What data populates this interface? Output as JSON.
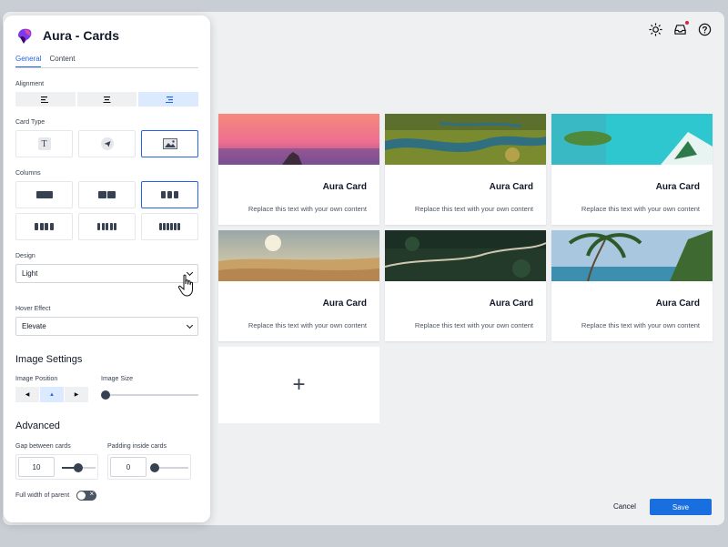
{
  "app": {
    "title": "Aura - Cards"
  },
  "tabs": [
    {
      "label": "General"
    },
    {
      "label": "Content"
    }
  ],
  "panel": {
    "alignment_label": "Alignment",
    "card_type_label": "Card Type",
    "columns_label": "Columns",
    "design_label": "Design",
    "design_value": "Light",
    "hover_label": "Hover Effect",
    "hover_value": "Elevate",
    "image_settings_title": "Image Settings",
    "image_position_label": "Image Position",
    "image_size_label": "Image Size",
    "advanced_title": "Advanced",
    "gap_label": "Gap between cards",
    "gap_value": "10",
    "padding_label": "Padding inside cards",
    "padding_value": "0",
    "full_width_label": "Full width of parent",
    "card_type_glyph": "T"
  },
  "cards": [
    {
      "title": "Aura Card",
      "text": "Replace this text with your own content"
    },
    {
      "title": "Aura Card",
      "text": "Replace this text with your own content"
    },
    {
      "title": "Aura Card",
      "text": "Replace this text with your own content"
    },
    {
      "title": "Aura Card",
      "text": "Replace this text with your own content"
    },
    {
      "title": "Aura Card",
      "text": "Replace this text with your own content"
    },
    {
      "title": "Aura Card",
      "text": "Replace this text with your own content"
    }
  ],
  "add_card_glyph": "+",
  "footer": {
    "cancel": "Cancel",
    "save": "Save"
  },
  "colors": {
    "accent": "#1a6fe0",
    "selected_bg": "#dbeafe",
    "notification": "#e11d48"
  }
}
